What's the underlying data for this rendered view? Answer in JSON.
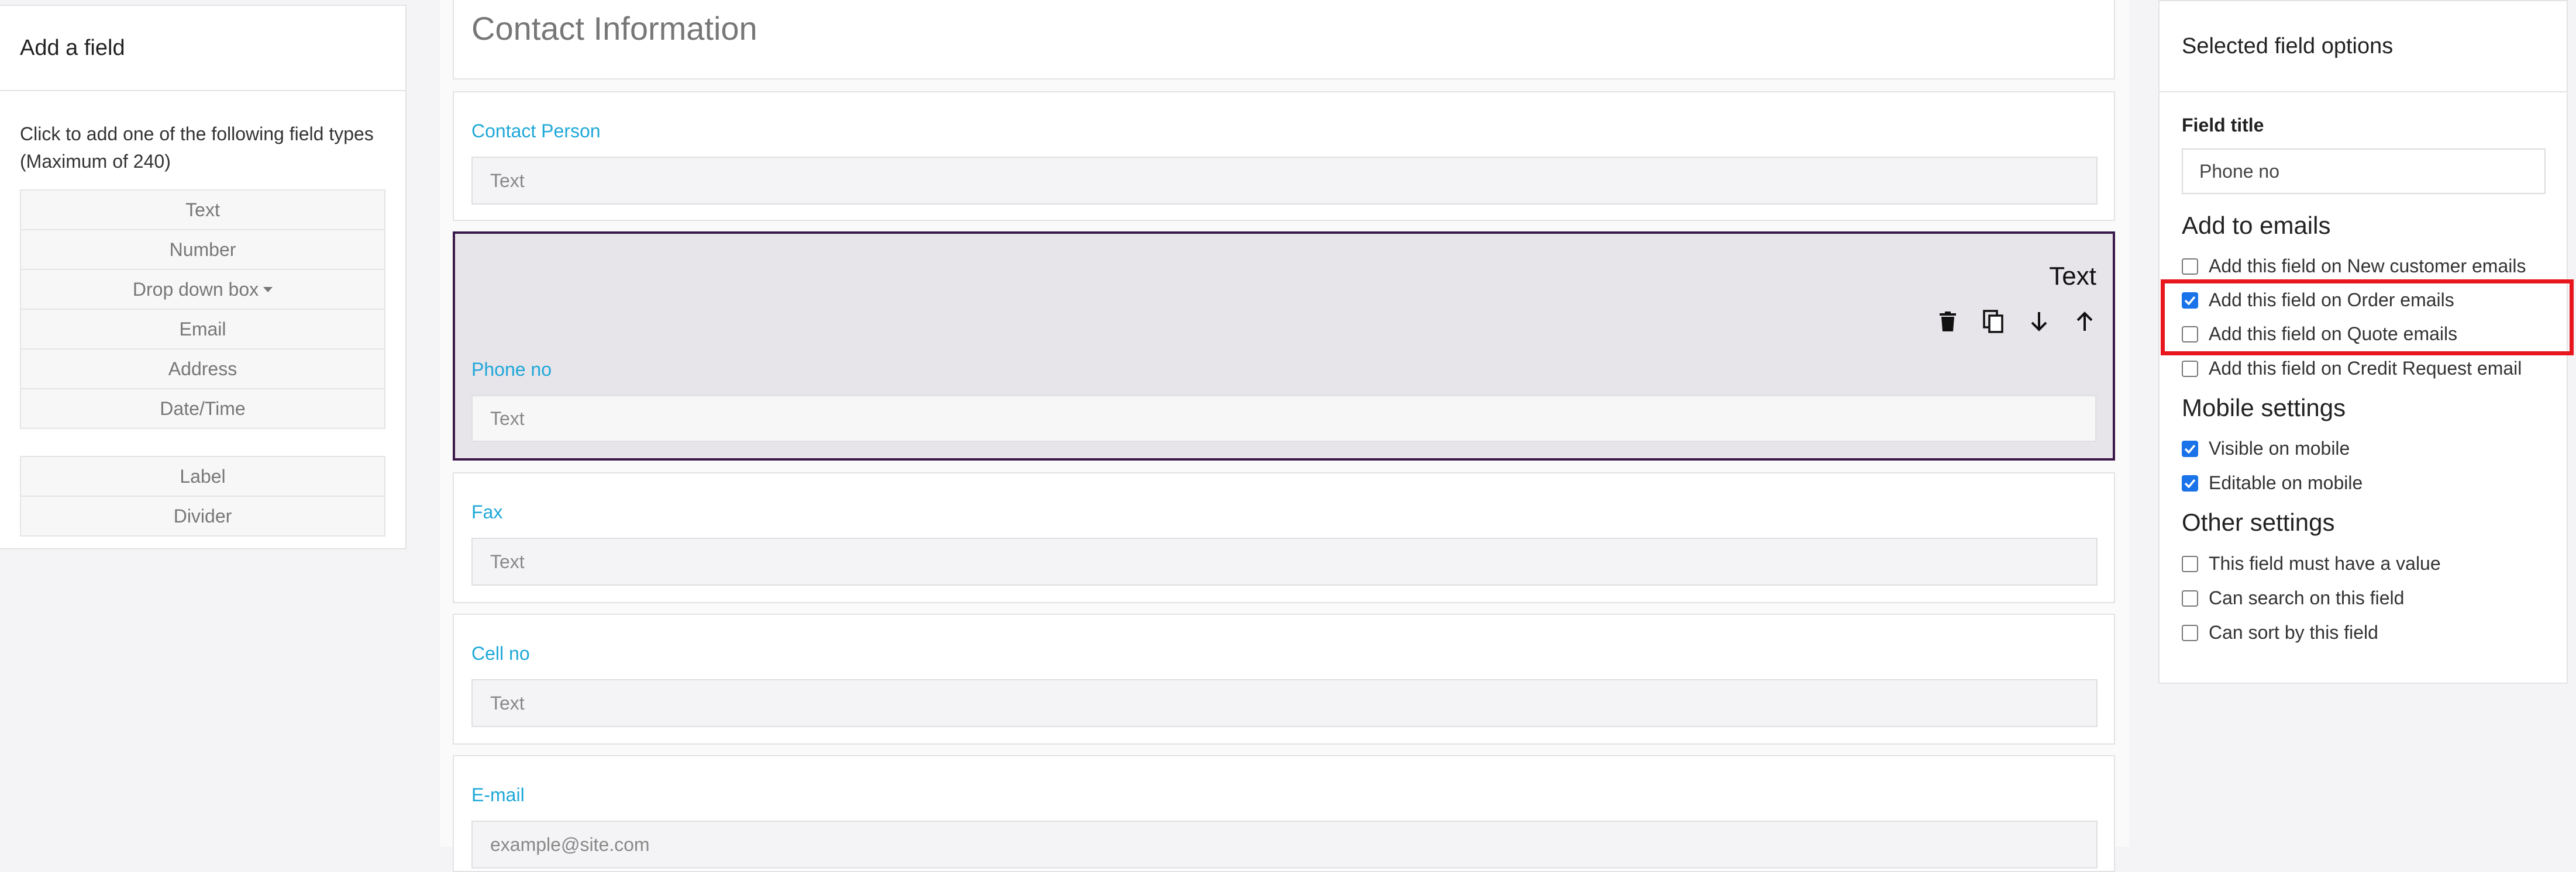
{
  "add_field": {
    "title": "Add a field",
    "intro": "Click to add one of the following field types (Maximum of 240)",
    "types": [
      "Text",
      "Number",
      "Drop down box",
      "Email",
      "Address",
      "Date/Time"
    ],
    "extras": [
      "Label",
      "Divider"
    ]
  },
  "form": {
    "section_title": "Contact Information",
    "fields": {
      "contact_person": {
        "label": "Contact Person",
        "placeholder": "Text"
      },
      "phone_no": {
        "label": "Phone no",
        "placeholder": "Text",
        "type_badge": "Text"
      },
      "fax": {
        "label": "Fax",
        "placeholder": "Text"
      },
      "cell_no": {
        "label": "Cell no",
        "placeholder": "Text"
      },
      "email": {
        "label": "E-mail",
        "placeholder": "example@site.com"
      }
    },
    "tool_icons": [
      "trash-icon",
      "copy-icon",
      "arrow-down-icon",
      "arrow-up-icon"
    ]
  },
  "options": {
    "title": "Selected field options",
    "field_title_label": "Field title",
    "field_title_value": "Phone no",
    "emails_heading": "Add to emails",
    "emails": [
      {
        "label": "Add this field on New customer emails",
        "checked": false
      },
      {
        "label": "Add this field on Order emails",
        "checked": true
      },
      {
        "label": "Add this field on Quote emails",
        "checked": false
      },
      {
        "label": "Add this field on Credit Request email",
        "checked": false
      }
    ],
    "mobile_heading": "Mobile settings",
    "mobile": [
      {
        "label": "Visible on mobile",
        "checked": true
      },
      {
        "label": "Editable on mobile",
        "checked": true
      }
    ],
    "other_heading": "Other settings",
    "other": [
      {
        "label": "This field must have a value",
        "checked": false
      },
      {
        "label": "Can search on this field",
        "checked": false
      },
      {
        "label": "Can sort by this field",
        "checked": false
      }
    ]
  },
  "colors": {
    "label_blue": "#1fa8d8",
    "selected_border": "#3b1a4a",
    "highlight_red": "#e8171e",
    "checkbox_blue": "#1a73e8"
  }
}
